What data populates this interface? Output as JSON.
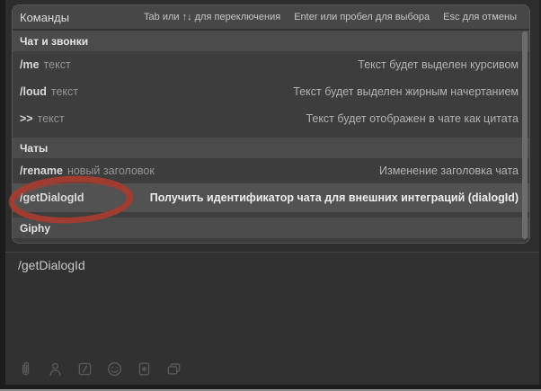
{
  "palette": {
    "title": "Команды",
    "hints": [
      "Tab или ↑↓ для переключения",
      "Enter или пробел для выбора",
      "Esc для отмены"
    ],
    "sections": [
      {
        "label": "Чат и звонки",
        "items": [
          {
            "command": "/me",
            "arg": "текст",
            "description": "Текст будет выделен курсивом",
            "selected": false
          },
          {
            "command": "/loud",
            "arg": "текст",
            "description": "Текст будет выделен жирным начертанием",
            "selected": false
          },
          {
            "command": ">>",
            "arg": "текст",
            "description": "Текст будет отображен в чате как цитата",
            "selected": false
          }
        ]
      },
      {
        "label": "Чаты",
        "items": [
          {
            "command": "/rename",
            "arg": "новый заголовок",
            "description": "Изменение заголовка чата",
            "selected": false
          },
          {
            "command": "/getDialogId",
            "arg": "",
            "description": "Получить идентификатор чата для внешних интеграций (dialogId)",
            "selected": true
          }
        ]
      },
      {
        "label": "Giphy",
        "items": []
      }
    ]
  },
  "composer": {
    "input_value": "/getDialogId",
    "toolbar_icons": [
      "paperclip",
      "person",
      "slash-command",
      "emoji-smiley",
      "sticker",
      "gallery"
    ]
  },
  "annotation": {
    "shape": "hand-drawn-ellipse",
    "color": "#a63c2f",
    "target_command": "/getDialogId"
  },
  "colors": {
    "selection_background": "#525252",
    "panel_background": "#3d3d3d",
    "annotation_red": "#a63c2f"
  }
}
